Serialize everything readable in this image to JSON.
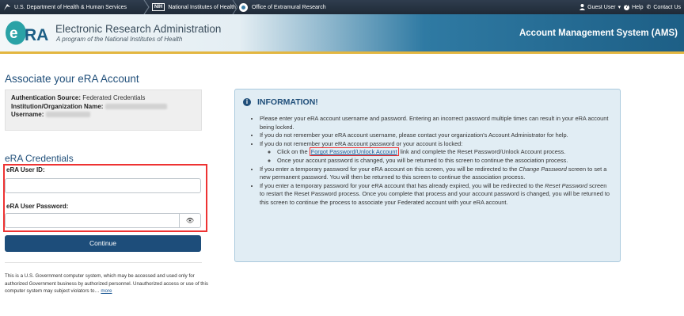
{
  "topbar": {
    "hhs": "U.S. Department of Health & Human Services",
    "nih_badge": "NIH",
    "nih": "National Institutes of Health",
    "oer": "Office of Extramural Research",
    "guest": "Guest User",
    "help": "Help",
    "contact": "Contact Us"
  },
  "header": {
    "title": "Electronic Research Administration",
    "subtitle": "A program of the National Institutes of Health",
    "system": "Account Management System (AMS)"
  },
  "page": {
    "title": "Associate your eRA Account",
    "auth_source_label": "Authentication Source:",
    "auth_source_value": "Federated Credentials",
    "institution_label": "Institution/Organization Name:",
    "username_label": "Username:",
    "cred_title": "eRA Credentials",
    "user_id_label": "eRA User ID:",
    "password_label": "eRA User Password:",
    "continue": "Continue",
    "notice": "This is a U.S. Government computer system, which may be accessed and used only for authorized Government business by authorized personnel. Unauthorized access or use of this computer system may subject violators to…",
    "more": "more"
  },
  "info": {
    "title": "INFORMATION!",
    "b1": "Please enter your eRA account username and password. Entering an incorrect password multiple times can result in your eRA account being locked.",
    "b2": "If you do not remember your eRA account username, please contact your organization's Account Administrator for help.",
    "b3": "If you do not remember your eRA account password or your account is locked:",
    "b3a_pre": "Click on the",
    "b3a_link": "Forgot Password/Unlock Account",
    "b3a_post": "link and complete the Reset Password/Unlock Account process.",
    "b3b": "Once your account password is changed, you will be returned to this screen to continue the association process.",
    "b4_pre": "If you enter a temporary password for your eRA account on this screen, you will be redirected to the",
    "b4_em": "Change Password",
    "b4_post": "screen to set a new permanent password. You will then be returned to this screen to continue the association process.",
    "b5_pre": "If you enter a temporary password for your eRA account that has already expired, you will be redirected to the",
    "b5_em": "Reset Password",
    "b5_post": "screen to restart the Reset Password process. Once you complete that process and your account password is changed, you will be returned to this screen to continue the process to associate your Federated account with your eRA account."
  },
  "colors": {
    "navy": "#1d4d7a",
    "gold": "#e3b640",
    "highlight": "#ee3333",
    "info_bg": "#e1edf4"
  },
  "icons": [
    "hhs-eagle-icon",
    "nih-badge-icon",
    "oer-logo-icon",
    "user-icon",
    "help-icon",
    "phone-icon",
    "info-icon",
    "eye-icon"
  ]
}
